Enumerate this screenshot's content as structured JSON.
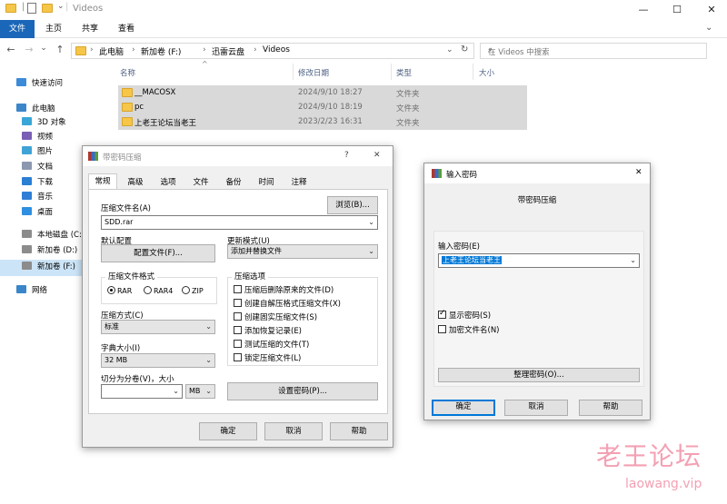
{
  "window": {
    "title": "Videos",
    "min": "—",
    "max": "☐",
    "close": "✕"
  },
  "ribbon": {
    "tabs": [
      "文件",
      "主页",
      "共享",
      "查看"
    ]
  },
  "nav": {
    "back": "←",
    "forward": "→",
    "recent": "⌄",
    "up": "↑",
    "refresh": "↻",
    "expand": "⌄"
  },
  "address": {
    "crumbs": [
      "此电脑",
      "新加卷 (F:)",
      "迅雷云盘",
      "Videos"
    ],
    "separator": "›"
  },
  "search": {
    "placeholder": "在 Videos 中搜索"
  },
  "sidebar": {
    "items": [
      {
        "label": "快速访问",
        "icon": "star-icon"
      },
      {
        "label": "此电脑",
        "icon": "computer-icon"
      },
      {
        "label": "3D 对象",
        "icon": "3d-objects-icon"
      },
      {
        "label": "视频",
        "icon": "video-folder-icon"
      },
      {
        "label": "图片",
        "icon": "pictures-folder-icon"
      },
      {
        "label": "文档",
        "icon": "documents-folder-icon"
      },
      {
        "label": "下载",
        "icon": "download-icon"
      },
      {
        "label": "音乐",
        "icon": "music-icon"
      },
      {
        "label": "桌面",
        "icon": "desktop-icon"
      },
      {
        "label": "本地磁盘 (C:)",
        "icon": "drive-icon"
      },
      {
        "label": "新加卷 (D:)",
        "icon": "drive-icon"
      },
      {
        "label": "新加卷 (F:)",
        "icon": "drive-icon"
      },
      {
        "label": "网络",
        "icon": "network-icon"
      }
    ]
  },
  "filelist": {
    "columns": {
      "name": "名称",
      "date": "修改日期",
      "type": "类型",
      "size": "大小"
    },
    "rows": [
      {
        "name": "__MACOSX",
        "date": "2024/9/10 18:27",
        "type": "文件夹"
      },
      {
        "name": "pc",
        "date": "2024/9/10 18:19",
        "type": "文件夹"
      },
      {
        "name": "上老王论坛当老王",
        "date": "2023/2/23 16:31",
        "type": "文件夹"
      }
    ]
  },
  "archive_dialog": {
    "title": "带密码压缩",
    "help": "?",
    "close": "✕",
    "tabs": [
      "常规",
      "高级",
      "选项",
      "文件",
      "备份",
      "时间",
      "注释"
    ],
    "archive_name_label": "压缩文件名(A)",
    "archive_name_value": "SDD.rar",
    "browse": "浏览(B)...",
    "profile_label": "默认配置",
    "profile_button": "配置文件(F)...",
    "update_mode_label": "更新模式(U)",
    "update_mode_value": "添加并替换文件",
    "format_group": "压缩文件格式",
    "formats": [
      "RAR",
      "RAR4",
      "ZIP"
    ],
    "options_group": "压缩选项",
    "options": [
      {
        "label": "压缩后删除原来的文件(D)",
        "checked": false
      },
      {
        "label": "创建自解压格式压缩文件(X)",
        "checked": false
      },
      {
        "label": "创建固实压缩文件(S)",
        "checked": false
      },
      {
        "label": "添加恢复记录(E)",
        "checked": false
      },
      {
        "label": "测试压缩的文件(T)",
        "checked": false
      },
      {
        "label": "锁定压缩文件(L)",
        "checked": false
      }
    ],
    "method_label": "压缩方式(C)",
    "method_value": "标准",
    "dict_label": "字典大小(I)",
    "dict_value": "32 MB",
    "split_label": "切分为分卷(V)，大小",
    "split_value": "",
    "split_unit": "MB",
    "set_password": "设置密码(P)...",
    "ok": "确定",
    "cancel": "取消",
    "helpbtn": "帮助"
  },
  "password_dialog": {
    "title": "输入密码",
    "close": "✕",
    "heading": "带密码压缩",
    "enter_label": "输入密码(E)",
    "password_value": "上老王论坛当老王",
    "show_password": {
      "label": "显示密码(S)",
      "checked": true
    },
    "encrypt_names": {
      "label": "加密文件名(N)",
      "checked": false
    },
    "organize": "整理密码(O)...",
    "ok": "确定",
    "cancel": "取消",
    "help": "帮助"
  },
  "watermark": {
    "text": "老王论坛",
    "url": "laowang.vip"
  },
  "colors": {
    "accent": "#1a66b8",
    "selection": "#0078d7",
    "row_highlight": "#d9d9d9",
    "watermark": "#f4a0b3"
  }
}
